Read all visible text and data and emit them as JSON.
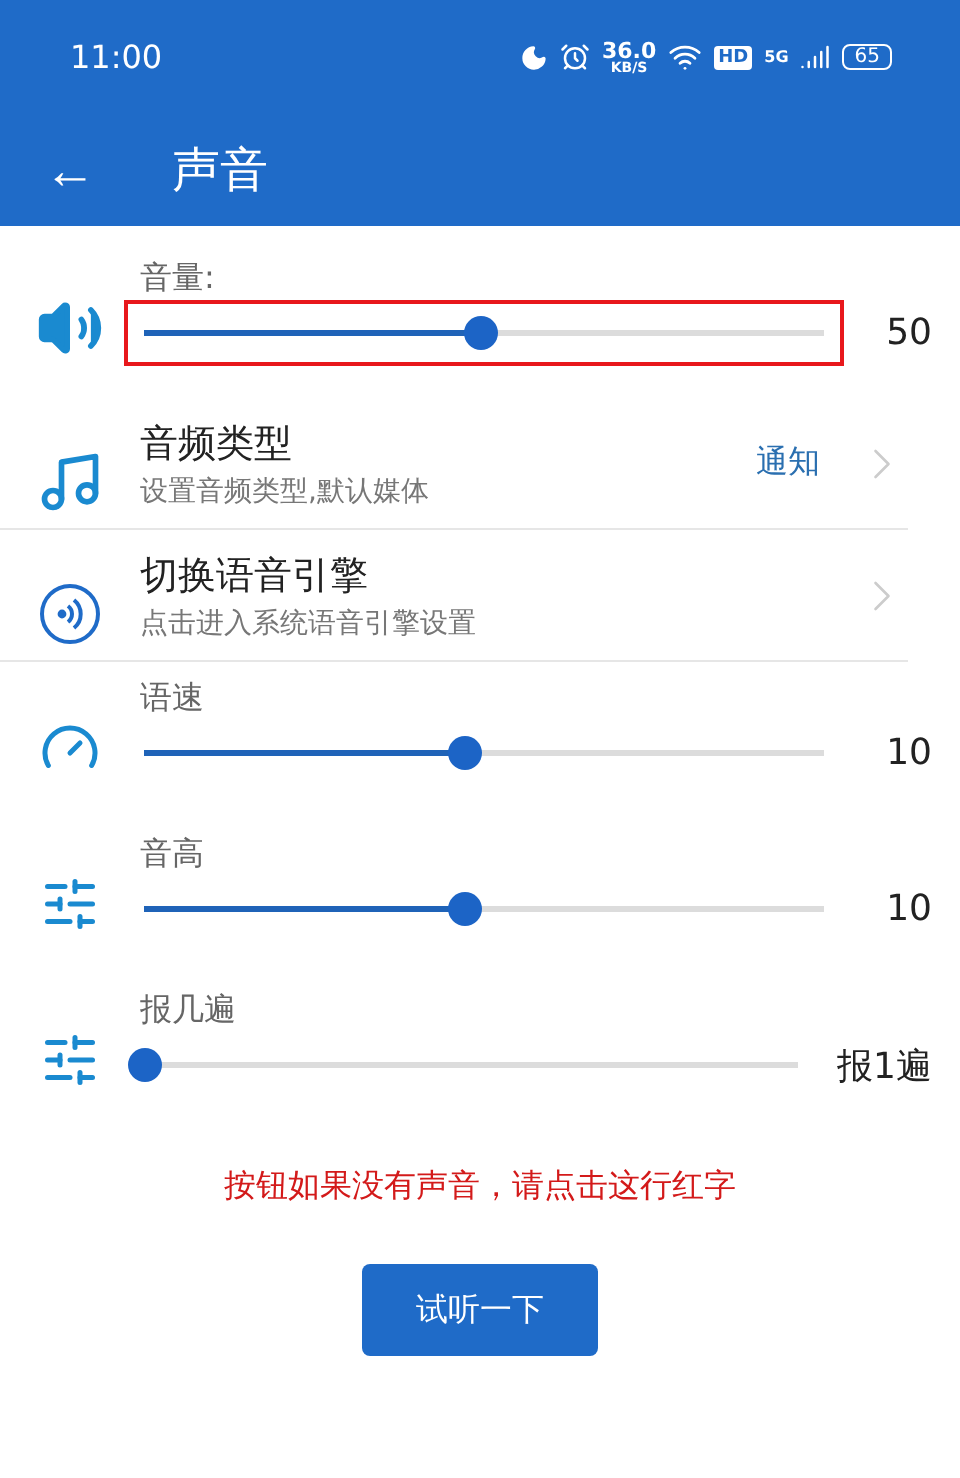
{
  "status_bar": {
    "time": "11:00",
    "speed": "36.0",
    "speed_unit": "KB/S",
    "hd": "HD",
    "network": "5G",
    "battery": "65"
  },
  "app_bar": {
    "back": "←",
    "title": "声音"
  },
  "items": [
    {
      "kind": "slider",
      "label": "音量:",
      "level": 0.495,
      "reading": "50",
      "highlighted": true
    },
    {
      "kind": "link",
      "title": "音频类型",
      "subtitle": "设置音频类型,默认媒体",
      "value": "通知"
    },
    {
      "kind": "link",
      "title": "切换语音引擎",
      "subtitle": "点击进入系统语音引擎设置"
    },
    {
      "kind": "slider",
      "label": "语速",
      "level": 0.47,
      "reading": "10",
      "highlighted": false
    },
    {
      "kind": "slider",
      "label": "音高",
      "level": 0.47,
      "reading": "10",
      "highlighted": false
    },
    {
      "kind": "slider",
      "label": "报几遍",
      "level": 0,
      "reading": "报1遍",
      "highlighted": false
    }
  ],
  "hint": "按钮如果没有声音，请点击这行红字",
  "button": "试听一下"
}
